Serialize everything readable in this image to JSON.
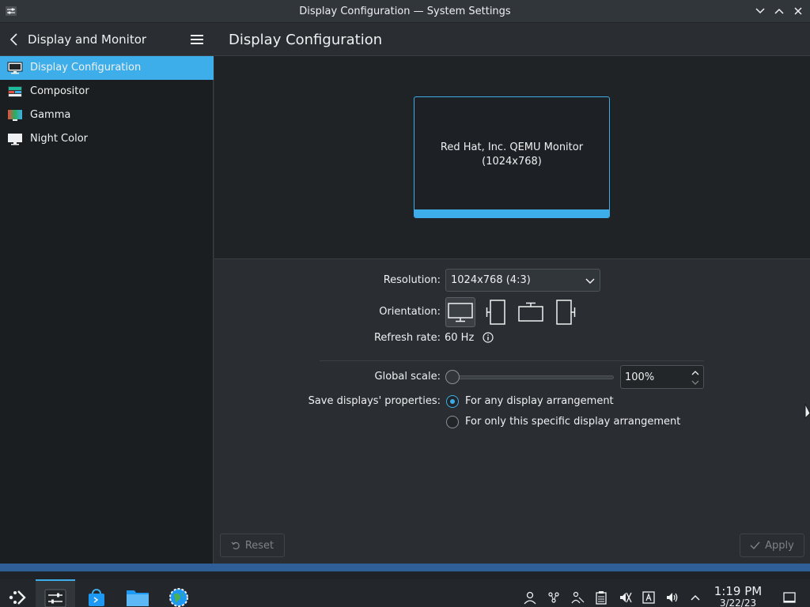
{
  "window": {
    "title": "Display Configuration — System Settings"
  },
  "sidebar": {
    "header": "Display and Monitor",
    "items": [
      {
        "label": "Display Configuration",
        "icon": "monitor-icon",
        "active": true
      },
      {
        "label": "Compositor",
        "icon": "compositor-icon",
        "active": false
      },
      {
        "label": "Gamma",
        "icon": "gamma-icon",
        "active": false
      },
      {
        "label": "Night Color",
        "icon": "night-color-icon",
        "active": false
      }
    ]
  },
  "main": {
    "title": "Display Configuration",
    "monitor": {
      "name": "Red Hat, Inc. QEMU Monitor",
      "resolution": "(1024x768)"
    },
    "resolution_label": "Resolution:",
    "resolution_value": "1024x768 (4:3)",
    "orientation_label": "Orientation:",
    "orientation_options": [
      "landscape",
      "rotate-left",
      "upside-down",
      "rotate-right"
    ],
    "refresh_label": "Refresh rate:",
    "refresh_value": "60 Hz",
    "scale_label": "Global scale:",
    "scale_value": "100%",
    "save_label": "Save displays' properties:",
    "save_options": [
      {
        "label": "For any display arrangement",
        "checked": true
      },
      {
        "label": "For only this specific display arrangement",
        "checked": false
      }
    ],
    "reset_label": "Reset",
    "apply_label": "Apply"
  },
  "taskbar": {
    "time": "1:19 PM",
    "date": "3/22/23"
  },
  "colors": {
    "accent": "#3daee9",
    "window_bg": "#2a2e32",
    "sidebar_bg": "#1b1e20",
    "panel_accent": "#2f5f96"
  }
}
